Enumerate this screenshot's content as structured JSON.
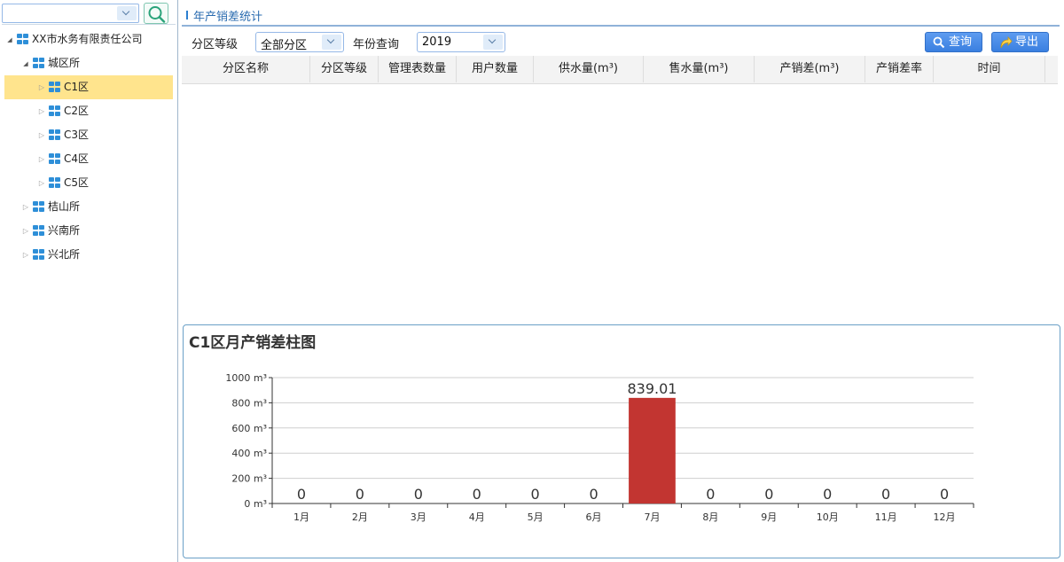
{
  "left": {
    "search": {
      "value": "",
      "icon": "search-icon"
    },
    "tree": [
      {
        "label": "XX市水务有限责任公司",
        "level": 0,
        "state": "open",
        "selected": false
      },
      {
        "label": "城区所",
        "level": 1,
        "state": "open",
        "selected": false
      },
      {
        "label": "C1区",
        "level": 2,
        "state": "closed",
        "selected": true
      },
      {
        "label": "C2区",
        "level": 2,
        "state": "closed",
        "selected": false
      },
      {
        "label": "C3区",
        "level": 2,
        "state": "closed",
        "selected": false
      },
      {
        "label": "C4区",
        "level": 2,
        "state": "closed",
        "selected": false
      },
      {
        "label": "C5区",
        "level": 2,
        "state": "closed",
        "selected": false
      },
      {
        "label": "桔山所",
        "level": 1,
        "state": "closed",
        "selected": false
      },
      {
        "label": "兴南所",
        "level": 1,
        "state": "closed",
        "selected": false
      },
      {
        "label": "兴北所",
        "level": 1,
        "state": "closed",
        "selected": false
      }
    ]
  },
  "header": {
    "title": "年产销差统计"
  },
  "toolbar": {
    "level_label": "分区等级",
    "level_value": "全部分区",
    "year_label": "年份查询",
    "year_value": "2019",
    "query_label": "查询",
    "export_label": "导出"
  },
  "grid": {
    "columns": [
      "分区名称",
      "分区等级",
      "管理表数量",
      "用户数量",
      "供水量(m³)",
      "售水量(m³)",
      "产销差(m³)",
      "产销差率",
      "时间"
    ],
    "rows": []
  },
  "chart_data": {
    "type": "bar",
    "title": "C1区月产销差柱图",
    "categories": [
      "1月",
      "2月",
      "3月",
      "4月",
      "5月",
      "6月",
      "7月",
      "8月",
      "9月",
      "10月",
      "11月",
      "12月"
    ],
    "values": [
      0,
      0,
      0,
      0,
      0,
      0,
      839.01,
      0,
      0,
      0,
      0,
      0
    ],
    "value_labels": [
      "0",
      "0",
      "0",
      "0",
      "0",
      "0",
      "839.01",
      "0",
      "0",
      "0",
      "0",
      "0"
    ],
    "ylim": [
      0,
      1000
    ],
    "yticks": [
      0,
      200,
      400,
      600,
      800,
      1000
    ],
    "ytick_labels": [
      "0 m³",
      "200 m³",
      "400 m³",
      "600 m³",
      "800 m³",
      "1000 m³"
    ],
    "bar_color": "#c23531",
    "grid": true
  }
}
